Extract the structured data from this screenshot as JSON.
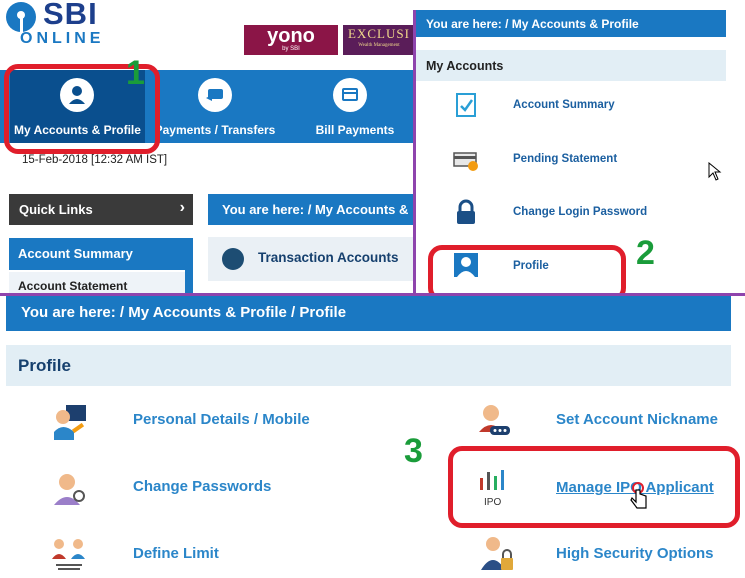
{
  "brand": {
    "logo_sbi": "SBI",
    "logo_online": "ONLINE",
    "yono": "yono",
    "yono_sub": "by SBI",
    "exclusive": "EXCLUSI",
    "exclusive_sub": "Wealth Management"
  },
  "nav": {
    "items": [
      {
        "label": "My Accounts & Profile",
        "icon": "user-icon"
      },
      {
        "label": "Payments / Transfers",
        "icon": "transfer-icon"
      },
      {
        "label": "Bill Payments",
        "icon": "bill-icon"
      }
    ]
  },
  "session_date": "15-Feb-2018 [12:32 AM IST]",
  "quick_links": {
    "label": "Quick Links",
    "arrow": "›"
  },
  "sidebar": {
    "active": "Account Summary",
    "next": "Account Statement"
  },
  "mid_breadcrumb": "You are here:  /   My Accounts &",
  "transaction_accounts": "Transaction Accounts",
  "panel": {
    "breadcrumb": "You are here:  /   My Accounts & Profile",
    "heading": "My Accounts",
    "items": [
      "Account Summary",
      "Pending Statement",
      "Change Login Password",
      "Profile"
    ]
  },
  "profile": {
    "breadcrumb": "You are here:  /   My Accounts & Profile  /   Profile",
    "heading": "Profile",
    "left_items": [
      "Personal Details / Mobile",
      "Change Passwords",
      "Define Limit"
    ],
    "right_items": [
      "Set Account Nickname",
      "Manage IPO Applicant",
      "High Security Options"
    ],
    "ipo_icon_label": "IPO"
  },
  "annotations": {
    "step1": "1",
    "step2": "2",
    "step3": "3"
  },
  "colors": {
    "primary_blue": "#1a78c2",
    "highlight_red": "#e01e2b",
    "step_green": "#1a9c3a",
    "divider_purple": "#8e44ad"
  }
}
